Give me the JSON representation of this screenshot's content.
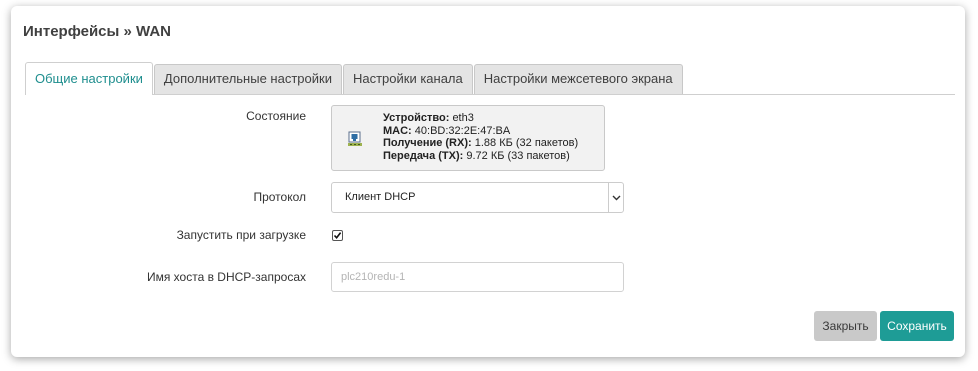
{
  "dialog": {
    "title": "Интерфейсы » WAN"
  },
  "tabs": [
    {
      "label": "Общие настройки",
      "active": true
    },
    {
      "label": "Дополнительные настройки",
      "active": false
    },
    {
      "label": "Настройки канала",
      "active": false
    },
    {
      "label": "Настройки межсетевого экрана",
      "active": false
    }
  ],
  "status": {
    "label": "Состояние",
    "icon": "ethernet-port-icon",
    "device_key": "Устройство:",
    "device_value": "eth3",
    "mac_key": "MAC:",
    "mac_value": "40:BD:32:2E:47:BA",
    "rx_key": "Получение (RX):",
    "rx_value": "1.88 КБ (32 пакетов)",
    "tx_key": "Передача (TX):",
    "tx_value": "9.72 КБ (33 пакетов)"
  },
  "protocol": {
    "label": "Протокол",
    "selected": "Клиент DHCP"
  },
  "autostart": {
    "label": "Запустить при загрузке",
    "checked": true
  },
  "hostname": {
    "label": "Имя хоста в DHCP-запросах",
    "value": "",
    "placeholder": "plc210redu-1"
  },
  "buttons": {
    "close_label": "Закрыть",
    "save_label": "Сохранить"
  },
  "colors": {
    "accent": "#1e9c96",
    "active_tab_text": "#1e8e8e",
    "tab_background": "#e4e4e4",
    "close_button": "#c9c9c9"
  }
}
